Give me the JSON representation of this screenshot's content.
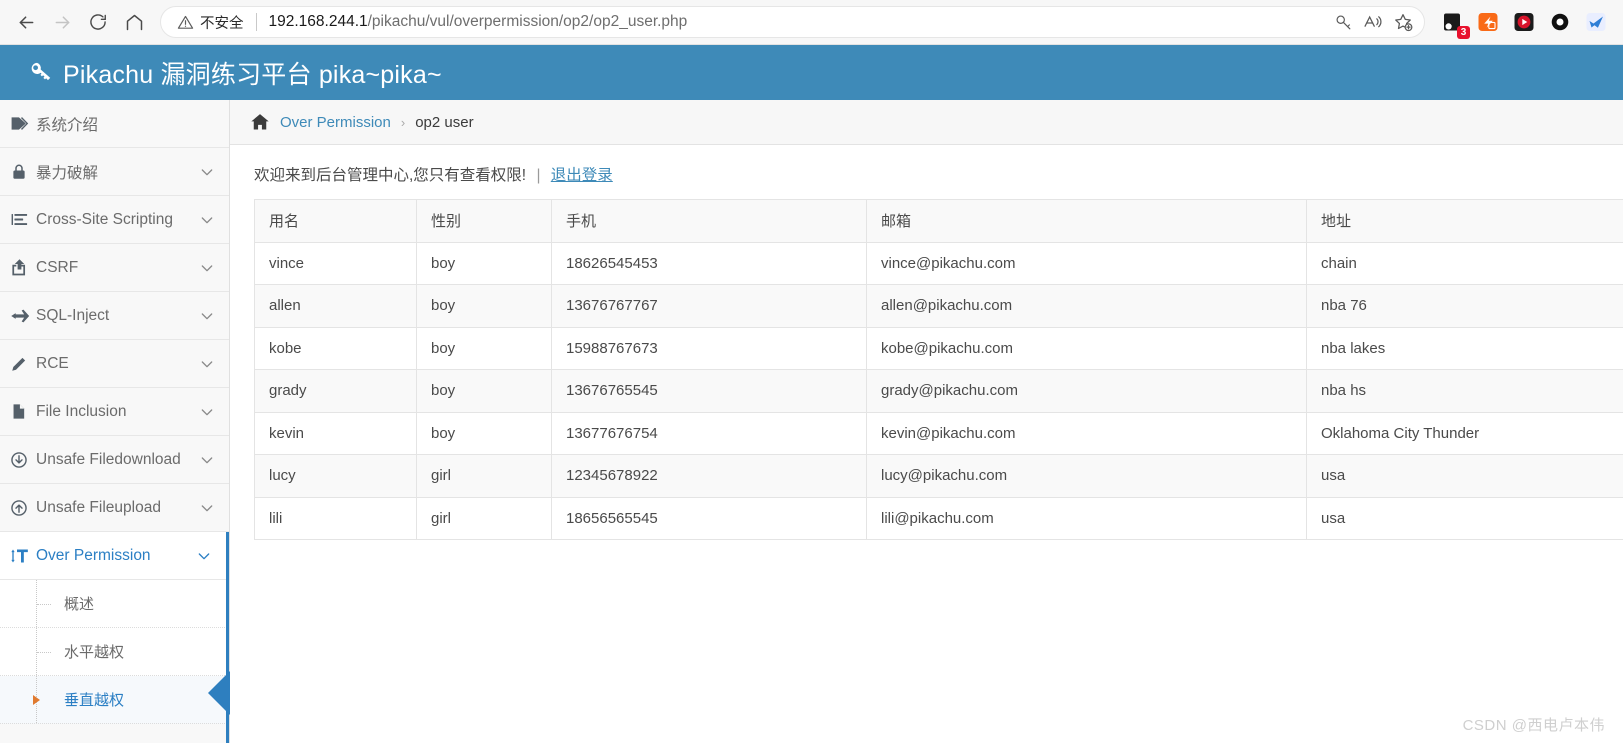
{
  "browser": {
    "back_label": "back-arrow",
    "forward_label": "forward-arrow",
    "reload_label": "reload",
    "home_label": "home",
    "security_text": "不安全",
    "url_host": "192.168.244.1",
    "url_path": "/pikachu/vul/overpermission/op2/op2_user.php",
    "url_full": "192.168.244.1/pikachu/vul/overpermission/op2/op2_user.php",
    "actions": [
      {
        "name": "key-icon",
        "label": "Password manager"
      },
      {
        "name": "read-aloud-icon",
        "label": "Read aloud"
      },
      {
        "name": "add-favorite-icon",
        "label": "Add to favorites"
      }
    ],
    "extensions": [
      {
        "name": "collections-extension-icon",
        "badge": "3"
      },
      {
        "name": "orange-extension-icon",
        "badge": ""
      },
      {
        "name": "video-extension-icon",
        "badge": ""
      },
      {
        "name": "ring-extension-icon",
        "badge": ""
      },
      {
        "name": "blue-bird-extension-icon",
        "badge": ""
      }
    ]
  },
  "header": {
    "icon": "key-icon",
    "title": "Pikachu 漏洞练习平台 pika~pika~",
    "bg_color": "#3e8ab8"
  },
  "sidebar": {
    "items": [
      {
        "icon": "tag-icon",
        "label": "系统介绍",
        "caret": false,
        "active": false
      },
      {
        "icon": "lock-icon",
        "label": "暴力破解",
        "caret": true,
        "active": false
      },
      {
        "icon": "align-left-icon",
        "label": "Cross-Site Scripting",
        "caret": true,
        "active": false
      },
      {
        "icon": "share-icon",
        "label": "CSRF",
        "caret": true,
        "active": false
      },
      {
        "icon": "paper-plane-icon",
        "label": "SQL-Inject",
        "caret": true,
        "active": false
      },
      {
        "icon": "pencil-icon",
        "label": "RCE",
        "caret": true,
        "active": false
      },
      {
        "icon": "file-icon",
        "label": "File Inclusion",
        "caret": true,
        "active": false
      },
      {
        "icon": "download-icon",
        "label": "Unsafe Filedownload",
        "caret": true,
        "active": false
      },
      {
        "icon": "upload-icon",
        "label": "Unsafe Fileupload",
        "caret": true,
        "active": false
      },
      {
        "icon": "text-height-icon",
        "label": "Over Permission",
        "caret": true,
        "active": true
      }
    ],
    "sub_items": [
      {
        "label": "概述",
        "current": false
      },
      {
        "label": "水平越权",
        "current": false
      },
      {
        "label": "垂直越权",
        "current": true
      }
    ],
    "active_color": "#2b7fc4"
  },
  "breadcrumb": {
    "home_icon": "home-icon",
    "parent": "Over Permission",
    "separator": "›",
    "current": "op2 user"
  },
  "content": {
    "welcome_text": "欢迎来到后台管理中心,您只有查看权限!",
    "pipe": "|",
    "logout_label": "退出登录"
  },
  "table": {
    "columns": [
      "用名",
      "性别",
      "手机",
      "邮箱",
      "地址"
    ],
    "rows": [
      [
        "vince",
        "boy",
        "18626545453",
        "vince@pikachu.com",
        "chain"
      ],
      [
        "allen",
        "boy",
        "13676767767",
        "allen@pikachu.com",
        "nba 76"
      ],
      [
        "kobe",
        "boy",
        "15988767673",
        "kobe@pikachu.com",
        "nba lakes"
      ],
      [
        "grady",
        "boy",
        "13676765545",
        "grady@pikachu.com",
        "nba hs"
      ],
      [
        "kevin",
        "boy",
        "13677676754",
        "kevin@pikachu.com",
        "Oklahoma City Thunder"
      ],
      [
        "lucy",
        "girl",
        "12345678922",
        "lucy@pikachu.com",
        "usa"
      ],
      [
        "lili",
        "girl",
        "18656565545",
        "lili@pikachu.com",
        "usa"
      ]
    ]
  },
  "watermark": {
    "text": "CSDN @西电卢本伟"
  }
}
